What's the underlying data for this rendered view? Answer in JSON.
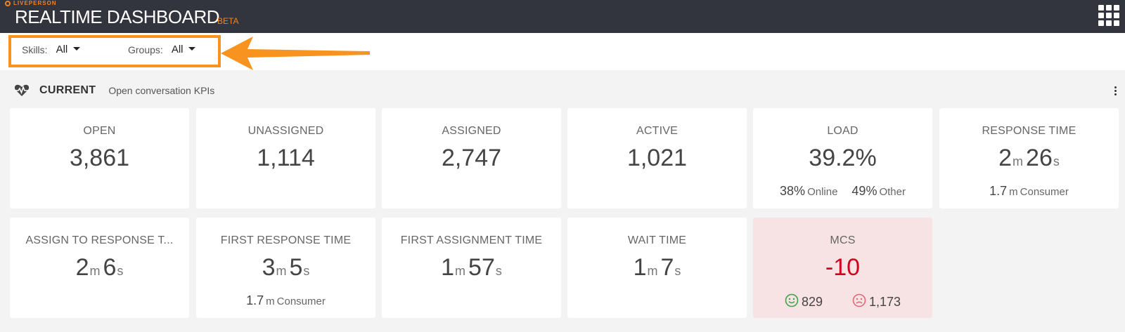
{
  "brand": {
    "name": "LIVEPERSON",
    "accent": "#f58220"
  },
  "header": {
    "title": "REALTIME DASHBOARD",
    "badge": "BETA",
    "apps_icon": "grid-apps-icon"
  },
  "filters": {
    "skills": {
      "label": "Skills:",
      "value": "All"
    },
    "groups": {
      "label": "Groups:",
      "value": "All"
    },
    "highlight_color": "#f7931e"
  },
  "section": {
    "title": "CURRENT",
    "subtitle": "Open conversation KPIs",
    "icon": "heart-pulse-icon"
  },
  "cards": {
    "open": {
      "title": "OPEN",
      "value": "3,861"
    },
    "unassigned": {
      "title": "UNASSIGNED",
      "value": "1,114"
    },
    "assigned": {
      "title": "ASSIGNED",
      "value": "2,747"
    },
    "active": {
      "title": "ACTIVE",
      "value": "1,021"
    },
    "load": {
      "title": "LOAD",
      "value": "39.2%",
      "online_value": "38%",
      "online_label": "Online",
      "other_value": "49%",
      "other_label": "Other"
    },
    "response_time": {
      "title": "RESPONSE TIME",
      "min": "2",
      "min_unit": "m",
      "sec": "26",
      "sec_unit": "s",
      "consumer_value": "1.7",
      "consumer_unit": "m",
      "consumer_label": "Consumer"
    },
    "assign_to_response": {
      "title": "ASSIGN TO RESPONSE T...",
      "min": "2",
      "min_unit": "m",
      "sec": "6",
      "sec_unit": "s"
    },
    "first_response_time": {
      "title": "FIRST RESPONSE TIME",
      "min": "3",
      "min_unit": "m",
      "sec": "5",
      "sec_unit": "s",
      "consumer_value": "1.7",
      "consumer_unit": "m",
      "consumer_label": "Consumer"
    },
    "first_assignment_time": {
      "title": "FIRST ASSIGNMENT TIME",
      "min": "1",
      "min_unit": "m",
      "sec": "57",
      "sec_unit": "s"
    },
    "wait_time": {
      "title": "WAIT TIME",
      "min": "1",
      "min_unit": "m",
      "sec": "7",
      "sec_unit": "s"
    },
    "mcs": {
      "title": "MCS",
      "value": "-10",
      "positive": "829",
      "negative": "1,173",
      "value_color": "#d0021b",
      "background": "#f8e3e4"
    }
  }
}
